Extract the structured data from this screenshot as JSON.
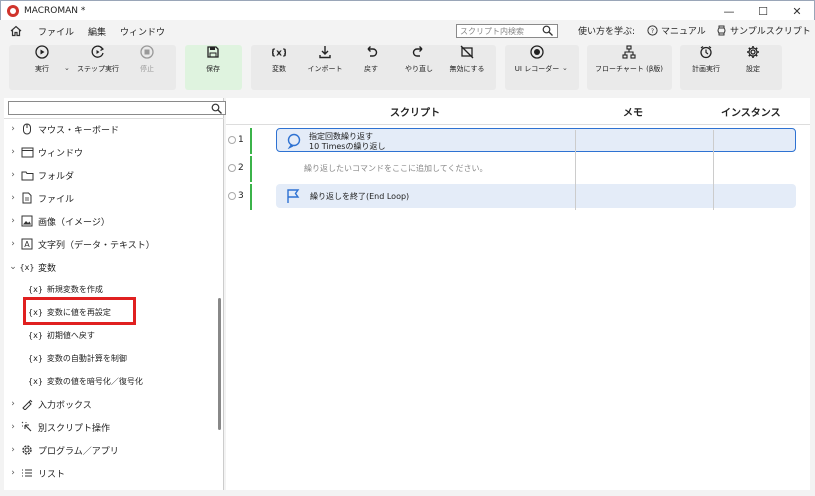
{
  "window": {
    "title": "MACROMAN *",
    "controls": [
      "—",
      "☐",
      "✕"
    ]
  },
  "menu": {
    "items": [
      "ファイル",
      "編集",
      "ウィンドウ"
    ]
  },
  "search": {
    "placeholder": "スクリプト内検索"
  },
  "help": {
    "learn": "使い方を学ぶ:",
    "manual": "マニュアル",
    "samples": "サンプルスクリプト"
  },
  "toolbar": {
    "run": "実行",
    "step": "ステップ実行",
    "stop": "停止",
    "save": "保存",
    "variable": "変数",
    "import": "インポート",
    "undo": "戻す",
    "redo": "やり直し",
    "disable": "無効にする",
    "ui_recorder": "UI レコーダー",
    "flowchart": "フローチャート (β版)",
    "schedule": "計画実行",
    "settings": "設定"
  },
  "sidebar": {
    "items": [
      {
        "label": "マウス・キーボード",
        "icon": "mouse-icon"
      },
      {
        "label": "ウィンドウ",
        "icon": "window-icon"
      },
      {
        "label": "フォルダ",
        "icon": "folder-icon"
      },
      {
        "label": "ファイル",
        "icon": "file-icon"
      },
      {
        "label": "画像（イメージ）",
        "icon": "image-icon"
      },
      {
        "label": "文字列（データ・テキスト）",
        "icon": "text-icon"
      },
      {
        "label": "変数",
        "icon": "variable-icon",
        "expanded": true
      },
      {
        "label": "入力ボックス",
        "icon": "input-box-icon"
      },
      {
        "label": "別スクリプト操作",
        "icon": "script-icon"
      },
      {
        "label": "プログラム／アプリ",
        "icon": "program-icon"
      },
      {
        "label": "リスト",
        "icon": "list-icon"
      }
    ],
    "sub_items": [
      "新規変数を作成",
      "変数に値を再設定",
      "初期値へ戻す",
      "変数の自動計算を制御",
      "変数の値を暗号化／復号化"
    ],
    "var_glyph": "{x}",
    "selected_sub_item": "変数に値を再設定"
  },
  "main": {
    "headers": {
      "script": "スクリプト",
      "memo": "メモ",
      "instance": "インスタンス"
    },
    "rows": [
      {
        "num": "1",
        "line1": "指定回数繰り返す",
        "line2": "10 Timesの繰り返し"
      },
      {
        "num": "2",
        "placeholder": "繰り返したいコマンドをここに追加してください。"
      },
      {
        "num": "3",
        "line1": "繰り返しを終了(End Loop)"
      }
    ]
  },
  "colors": {
    "accent": "#2e72d2",
    "green": "#3bb34a",
    "highlight": "#e02020",
    "save_bg": "#dff3df"
  }
}
